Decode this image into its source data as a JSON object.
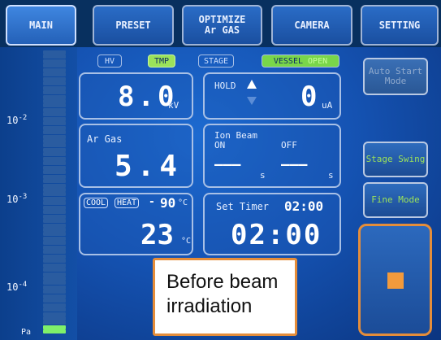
{
  "tabs": [
    {
      "label_line1": "MAIN",
      "label_line2": "",
      "active": true
    },
    {
      "label_line1": "PRESET",
      "label_line2": ""
    },
    {
      "label_line1": "OPTIMIZE",
      "label_line2": "Ar GAS"
    },
    {
      "label_line1": "CAMERA",
      "label_line2": ""
    },
    {
      "label_line1": "SETTING",
      "label_line2": ""
    }
  ],
  "scale": {
    "labels": [
      {
        "base": "10",
        "exp": "-2"
      },
      {
        "base": "10",
        "exp": "-3"
      },
      {
        "base": "10",
        "exp": "-4"
      }
    ],
    "unit": "Pa",
    "bars_total": 64,
    "bars_green": 2
  },
  "status_pills": {
    "hv": "HV",
    "tmp": "TMP",
    "stage": "STAGE",
    "vessel": "VESSEL",
    "vessel_state": "OPEN"
  },
  "voltage": {
    "value": "8.0",
    "unit": "kV"
  },
  "hold": {
    "label": "HOLD",
    "value": "0",
    "unit": "uA"
  },
  "ar_gas": {
    "label": "Ar Gas",
    "value": "5.4"
  },
  "ion_beam": {
    "label": "Ion Beam",
    "on_label": "ON",
    "off_label": "OFF",
    "on_value": "———",
    "off_value": "———",
    "unit": "s"
  },
  "temperature": {
    "cool": "COOL",
    "heat": "HEAT",
    "dash": "-",
    "setpoint": "90",
    "set_unit": "°C",
    "value": "23",
    "unit": "°C"
  },
  "timer": {
    "label": "Set Timer",
    "set": "02:00",
    "value": "02:00"
  },
  "right_buttons": {
    "auto_start": "Auto Start Mode",
    "stage_swing": "Stage Swing",
    "fine_mode": "Fine Mode"
  },
  "annotation": {
    "line1": "Before beam",
    "line2": "irradiation"
  },
  "colors": {
    "accent_green": "#9be25a",
    "stop_orange": "#f29a3c",
    "annotation_border": "#e58d3a"
  }
}
